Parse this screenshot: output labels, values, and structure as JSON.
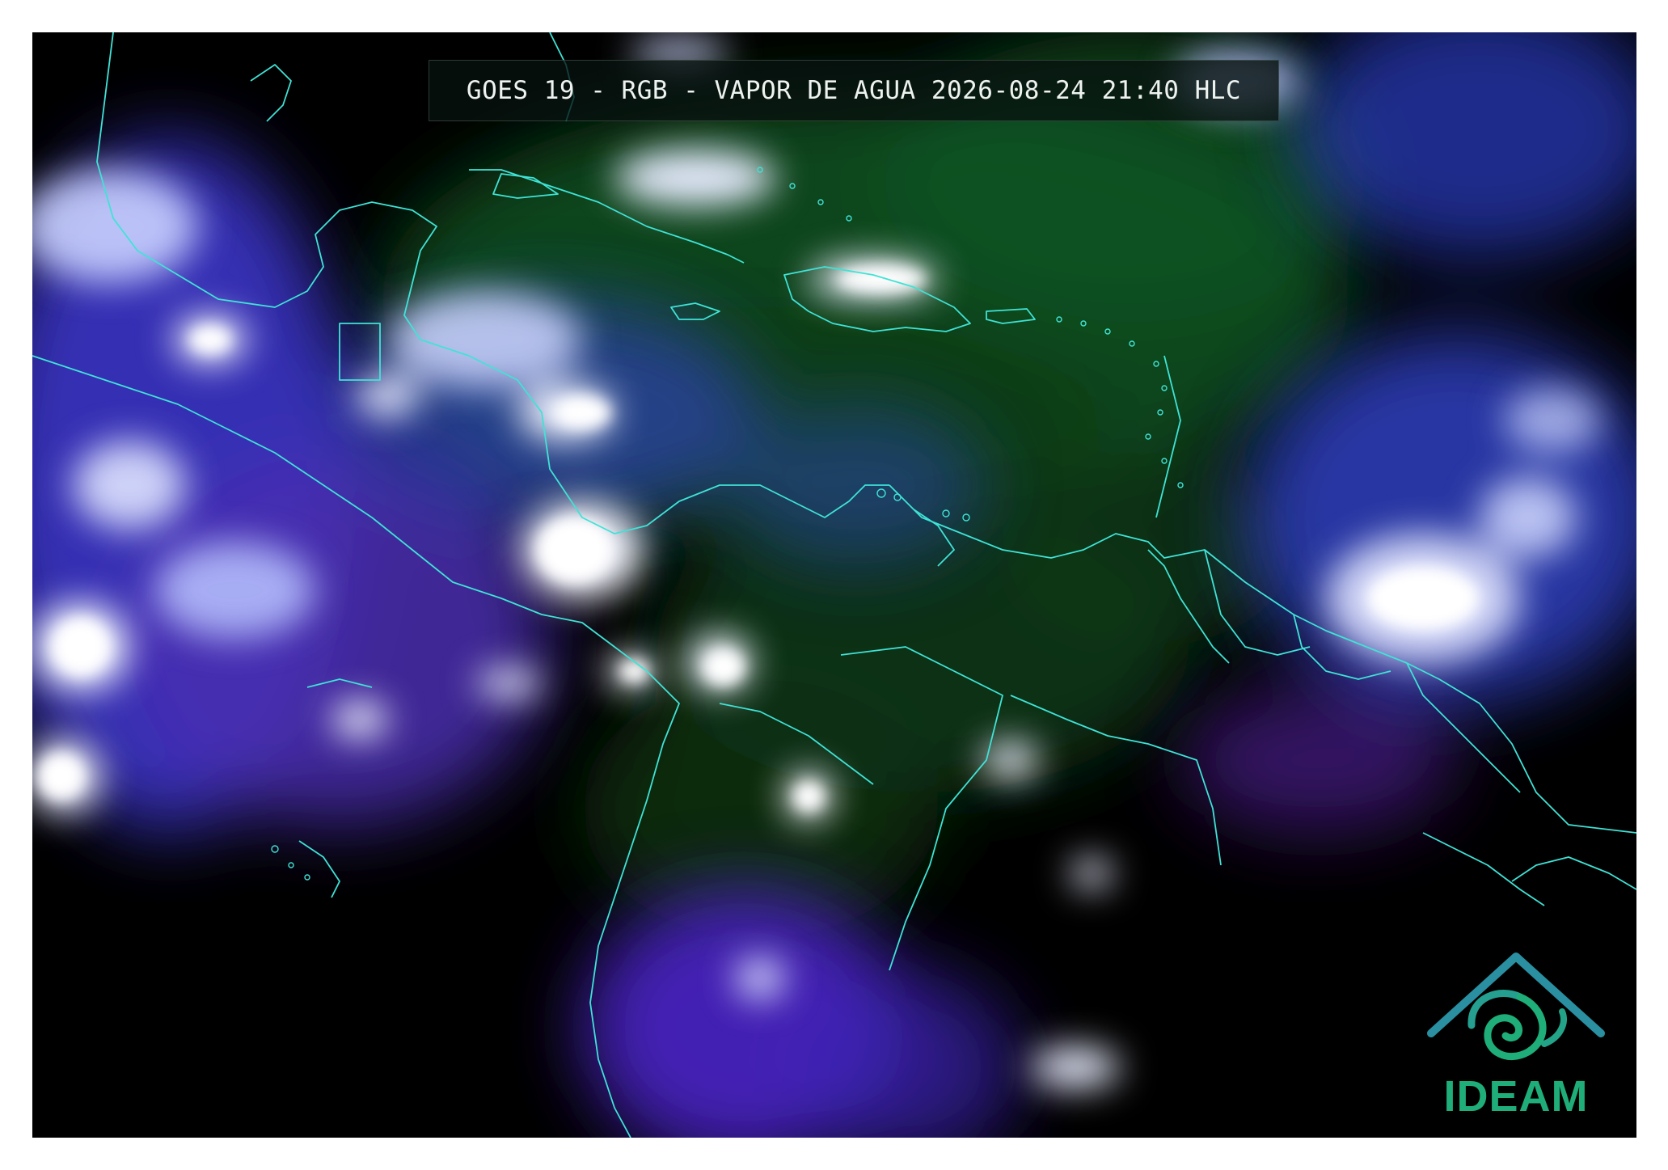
{
  "title": "GOES 19 - RGB - VAPOR DE AGUA 2026-08-24 21:40 HLC",
  "logo": {
    "text": "IDEAM",
    "color_top": "#2a8fa0",
    "color_bottom": "#1fae79"
  },
  "colors": {
    "background": "#000000",
    "border_lines": "#3fe3d6",
    "dry_air": "#0a3f16",
    "moist_air": "#3b2bd0",
    "clouds": "#e8ecff"
  }
}
